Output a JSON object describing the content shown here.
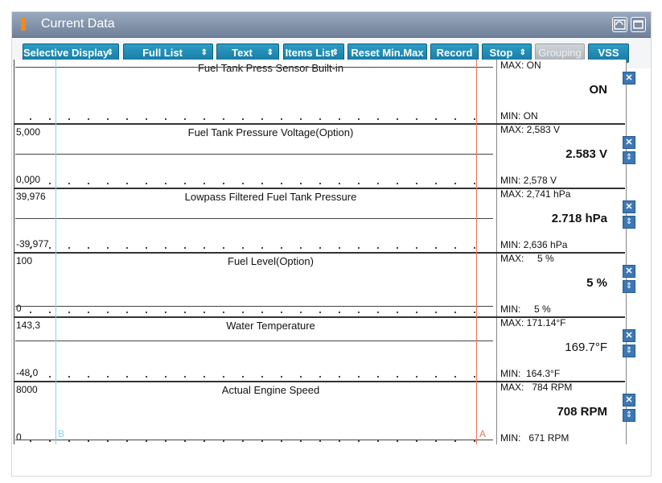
{
  "window": {
    "title": "Current Data"
  },
  "toolbar": {
    "selective_display": "Selective Display",
    "full_list": "Full List",
    "text": "Text",
    "items_list": "Items List",
    "reset": "Reset Min.Max",
    "record": "Record",
    "stop": "Stop",
    "grouping": "Grouping",
    "vss": "VSS",
    "dropdown_glyph": "⇕"
  },
  "cursors": {
    "b": "B",
    "a": "A"
  },
  "rows": [
    {
      "name": "Fuel Tank Press Sensor Built-in",
      "top": "",
      "bottom": "",
      "max": "MAX: ON",
      "cur": "ON",
      "min": "MIN: ON"
    },
    {
      "name": "Fuel Tank Pressure Voltage(Option)",
      "top": "5,000",
      "bottom": "0,000",
      "max": "MAX: 2,583 V",
      "cur": "2.583 V",
      "min": "MIN: 2,578 V"
    },
    {
      "name": "Lowpass Filtered Fuel Tank Pressure",
      "top": "39,976",
      "bottom": "-39,977",
      "max": "MAX: 2,741 hPa",
      "cur": "2.718 hPa",
      "min": "MIN: 2,636 hPa"
    },
    {
      "name": "Fuel Level(Option)",
      "top": "100",
      "bottom": "0",
      "max": "MAX:     5 %",
      "cur": "5 %",
      "min": "MIN:     5 %"
    },
    {
      "name": "Water Temperature",
      "top": "143,3",
      "bottom": "-48,0",
      "max": "MAX: 171.14°F",
      "cur": "169.7°F",
      "min": "MIN:  164.3°F"
    },
    {
      "name": "Actual Engine Speed",
      "top": "8000",
      "bottom": "0",
      "max": "MAX:   784 RPM",
      "cur": "708 RPM",
      "min": "MIN:   671 RPM"
    }
  ],
  "buttons": {
    "close": "✕",
    "scroll": "⇕"
  }
}
